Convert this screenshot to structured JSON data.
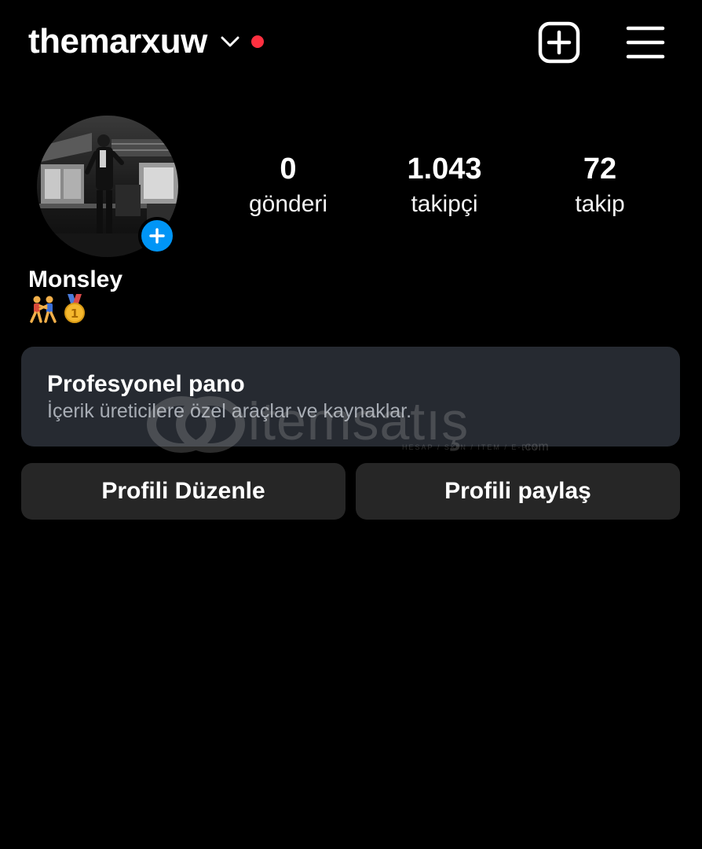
{
  "header": {
    "username": "themarxuw",
    "chevron_icon": "chevron-down-icon",
    "notification_dot_color": "#ff3040",
    "new_post_icon": "plus-square-icon",
    "menu_icon": "hamburger-menu-icon"
  },
  "profile": {
    "avatar_add_icon": "plus-icon",
    "avatar_add_color": "#0095f6",
    "stats": [
      {
        "value": "0",
        "label": "gönderi"
      },
      {
        "value": "1.043",
        "label": "takipçi"
      },
      {
        "value": "72",
        "label": "takip"
      }
    ],
    "display_name": "Monsley",
    "bio_emojis": [
      "wrestlers-emoji",
      "first-place-medal-emoji"
    ]
  },
  "pro_dashboard": {
    "title": "Profesyonel pano",
    "subtitle": "İçerik üreticilere özel araçlar ve kaynaklar."
  },
  "actions": {
    "edit_label": "Profili Düzenle",
    "share_label": "Profili paylaş"
  },
  "watermark": {
    "text": "itemsatış",
    "subtext": "HESAP / SKIN / ITEM / E-PIN",
    "suffix": ".com"
  }
}
